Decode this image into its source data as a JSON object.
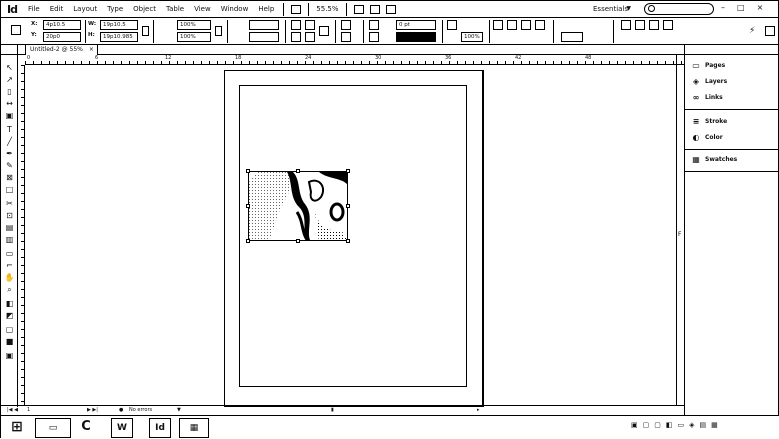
{
  "app": {
    "logo": "Id",
    "menu": [
      "File",
      "Edit",
      "Layout",
      "Type",
      "Object",
      "Table",
      "View",
      "Window",
      "Help"
    ],
    "zoom": "55.5%",
    "workspace": "Essentials",
    "search_placeholder": "",
    "window_buttons": [
      "–",
      "□",
      "×"
    ]
  },
  "control": {
    "x_label": "X:",
    "x_value": "4p10.5",
    "y_label": "Y:",
    "y_value": "20p0",
    "w_label": "W:",
    "w_value": "19p10.5",
    "h_label": "H:",
    "h_value": "19p10.985",
    "scale_x": "100%",
    "scale_y": "100%",
    "stroke_weight": "0 pt",
    "opacity": "100%"
  },
  "document": {
    "tab_label": "Untitled-2 @ 55%",
    "tab_close": "×",
    "ruler_labels": [
      "0",
      "6",
      "12",
      "18",
      "24",
      "30",
      "36",
      "42",
      "48"
    ]
  },
  "status": {
    "page": "1",
    "errors": "No errors"
  },
  "panels": {
    "group1": [
      {
        "icon": "pages-icon",
        "glyph": "▭",
        "label": "Pages"
      },
      {
        "icon": "layers-icon",
        "glyph": "◈",
        "label": "Layers"
      },
      {
        "icon": "links-icon",
        "glyph": "∞",
        "label": "Links"
      }
    ],
    "group2": [
      {
        "icon": "stroke-icon",
        "glyph": "≡",
        "label": "Stroke"
      },
      {
        "icon": "color-icon",
        "glyph": "◐",
        "label": "Color"
      }
    ],
    "group3": [
      {
        "icon": "swatches-icon",
        "glyph": "▦",
        "label": "Swatches"
      }
    ]
  },
  "taskbar": {
    "items": [
      "⊞",
      "▭",
      "C",
      "W",
      "Id",
      "▦"
    ]
  }
}
